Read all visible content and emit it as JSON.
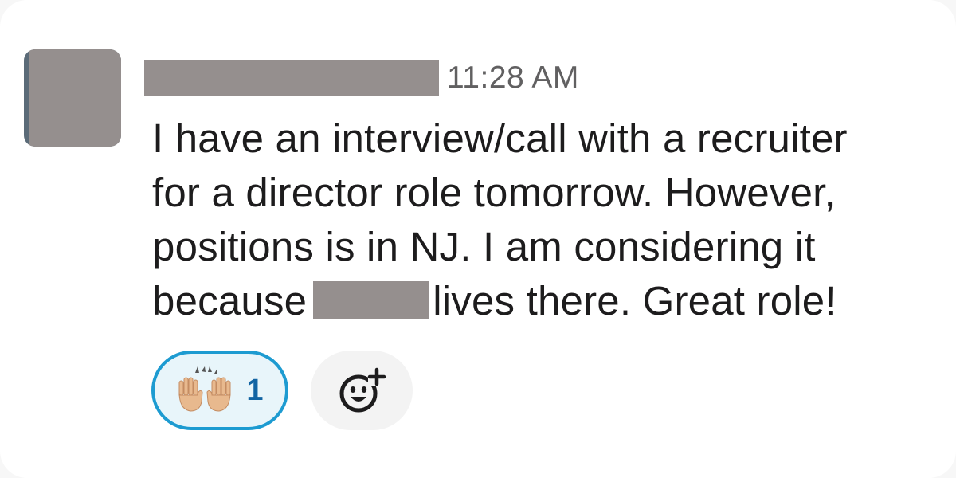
{
  "message": {
    "timestamp": "11:28 AM",
    "lines": [
      "I have an interview/call with a recruiter",
      "for a director role tomorrow. However,",
      "positions is in NJ. I am considering it"
    ],
    "last_line_before": "because",
    "last_line_after": "lives there. Great role!"
  },
  "reactions": [
    {
      "emoji": "raised-hands-icon",
      "count": "1",
      "selected": true
    }
  ],
  "colors": {
    "accent": "#1d9bd1",
    "count_text": "#1264a3",
    "text": "#1d1c1d",
    "muted": "#616061",
    "redaction": "#958f8e"
  }
}
